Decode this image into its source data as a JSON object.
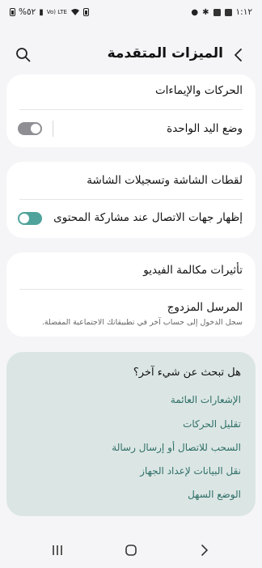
{
  "status_bar": {
    "battery_text": "%٥٢",
    "network_text": "Vo) LTE",
    "time": "١:١٢"
  },
  "header": {
    "title": "الميزات المتقدمة"
  },
  "group1": {
    "motions_label": "الحركات والإيماءات",
    "one_hand_label": "وضع اليد الواحدة",
    "one_hand_enabled": false
  },
  "group2": {
    "screenshots_label": "لقطات الشاشة وتسجيلات الشاشة",
    "show_contacts_label": "إظهار جهات الاتصال عند مشاركة المحتوى",
    "show_contacts_enabled": true
  },
  "group3": {
    "video_effects_label": "تأثيرات مكالمة الفيديو",
    "dual_messenger_label": "المرسل المزدوج",
    "dual_messenger_sub": "سجل الدخول إلى حساب آخر في تطبيقاتك الاجتماعية المفضلة."
  },
  "suggestions": {
    "title": "هل تبحث عن شيء آخر؟",
    "links": [
      "الإشعارات العائمة",
      "تقليل الحركات",
      "السحب للاتصال أو إرسال رسالة",
      "نقل البيانات لإعداد الجهاز",
      "الوضع السهل"
    ]
  },
  "colors": {
    "accent": "#4fa39a",
    "link": "#2f6f67",
    "suggest_bg": "#dbe6e4"
  }
}
